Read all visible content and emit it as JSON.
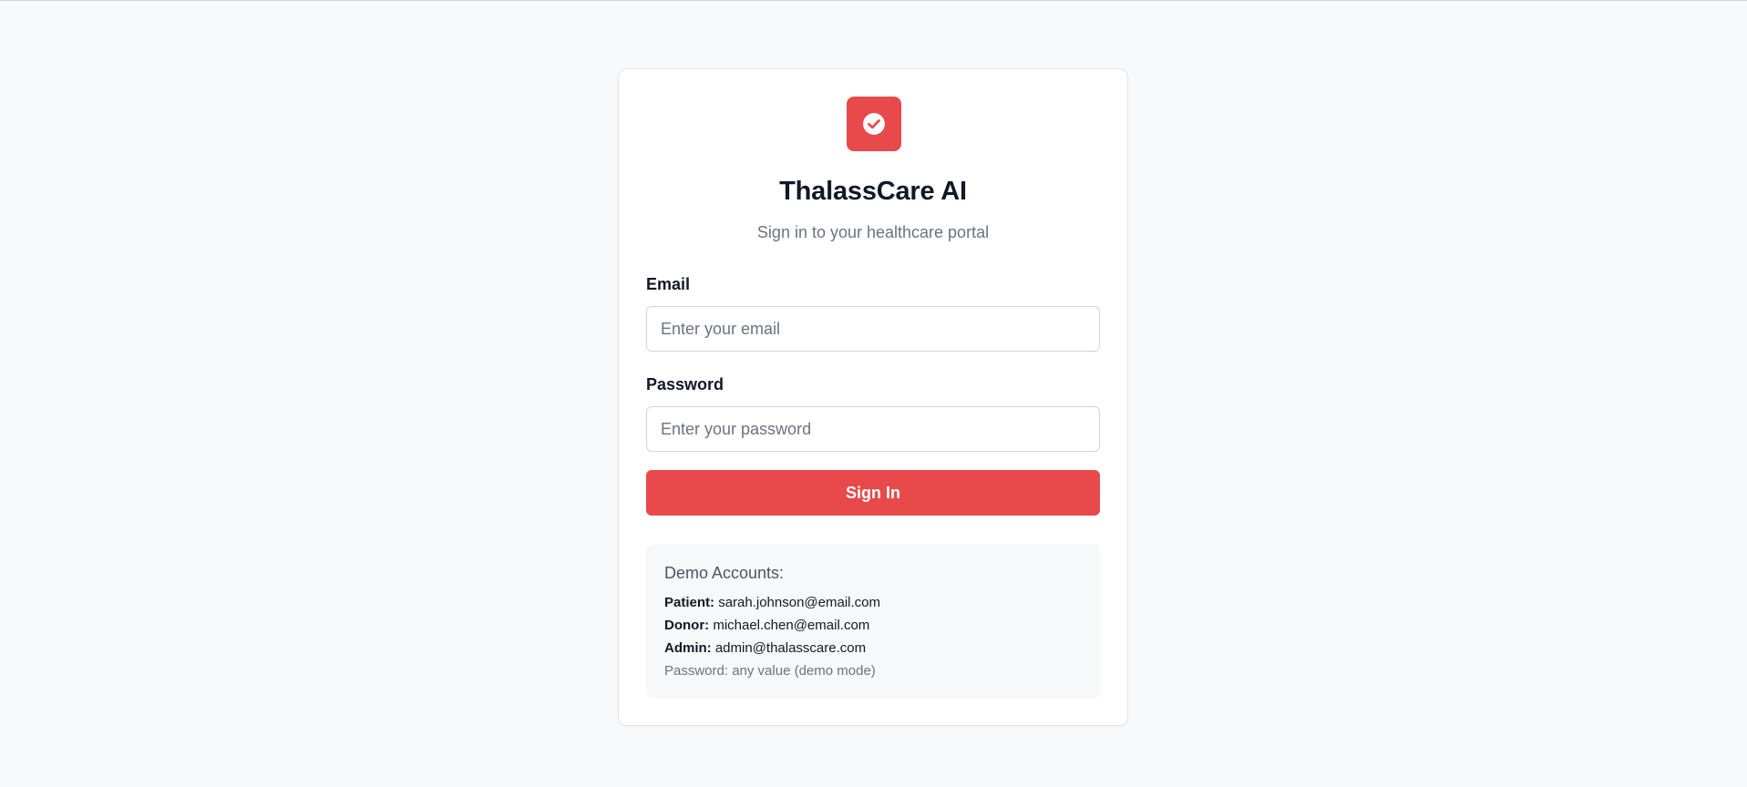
{
  "app": {
    "title": "ThalassCare AI",
    "subtitle": "Sign in to your healthcare portal",
    "logo_icon": "check-circle-icon",
    "accent_color": "#e84a4c"
  },
  "form": {
    "email_label": "Email",
    "email_placeholder": "Enter your email",
    "email_value": "",
    "password_label": "Password",
    "password_placeholder": "Enter your password",
    "password_value": "",
    "submit_label": "Sign In"
  },
  "demo": {
    "title": "Demo Accounts:",
    "accounts": [
      {
        "role": "Patient:",
        "email": "sarah.johnson@email.com"
      },
      {
        "role": "Donor:",
        "email": "michael.chen@email.com"
      },
      {
        "role": "Admin:",
        "email": "admin@thalasscare.com"
      }
    ],
    "note": "Password: any value (demo mode)"
  }
}
